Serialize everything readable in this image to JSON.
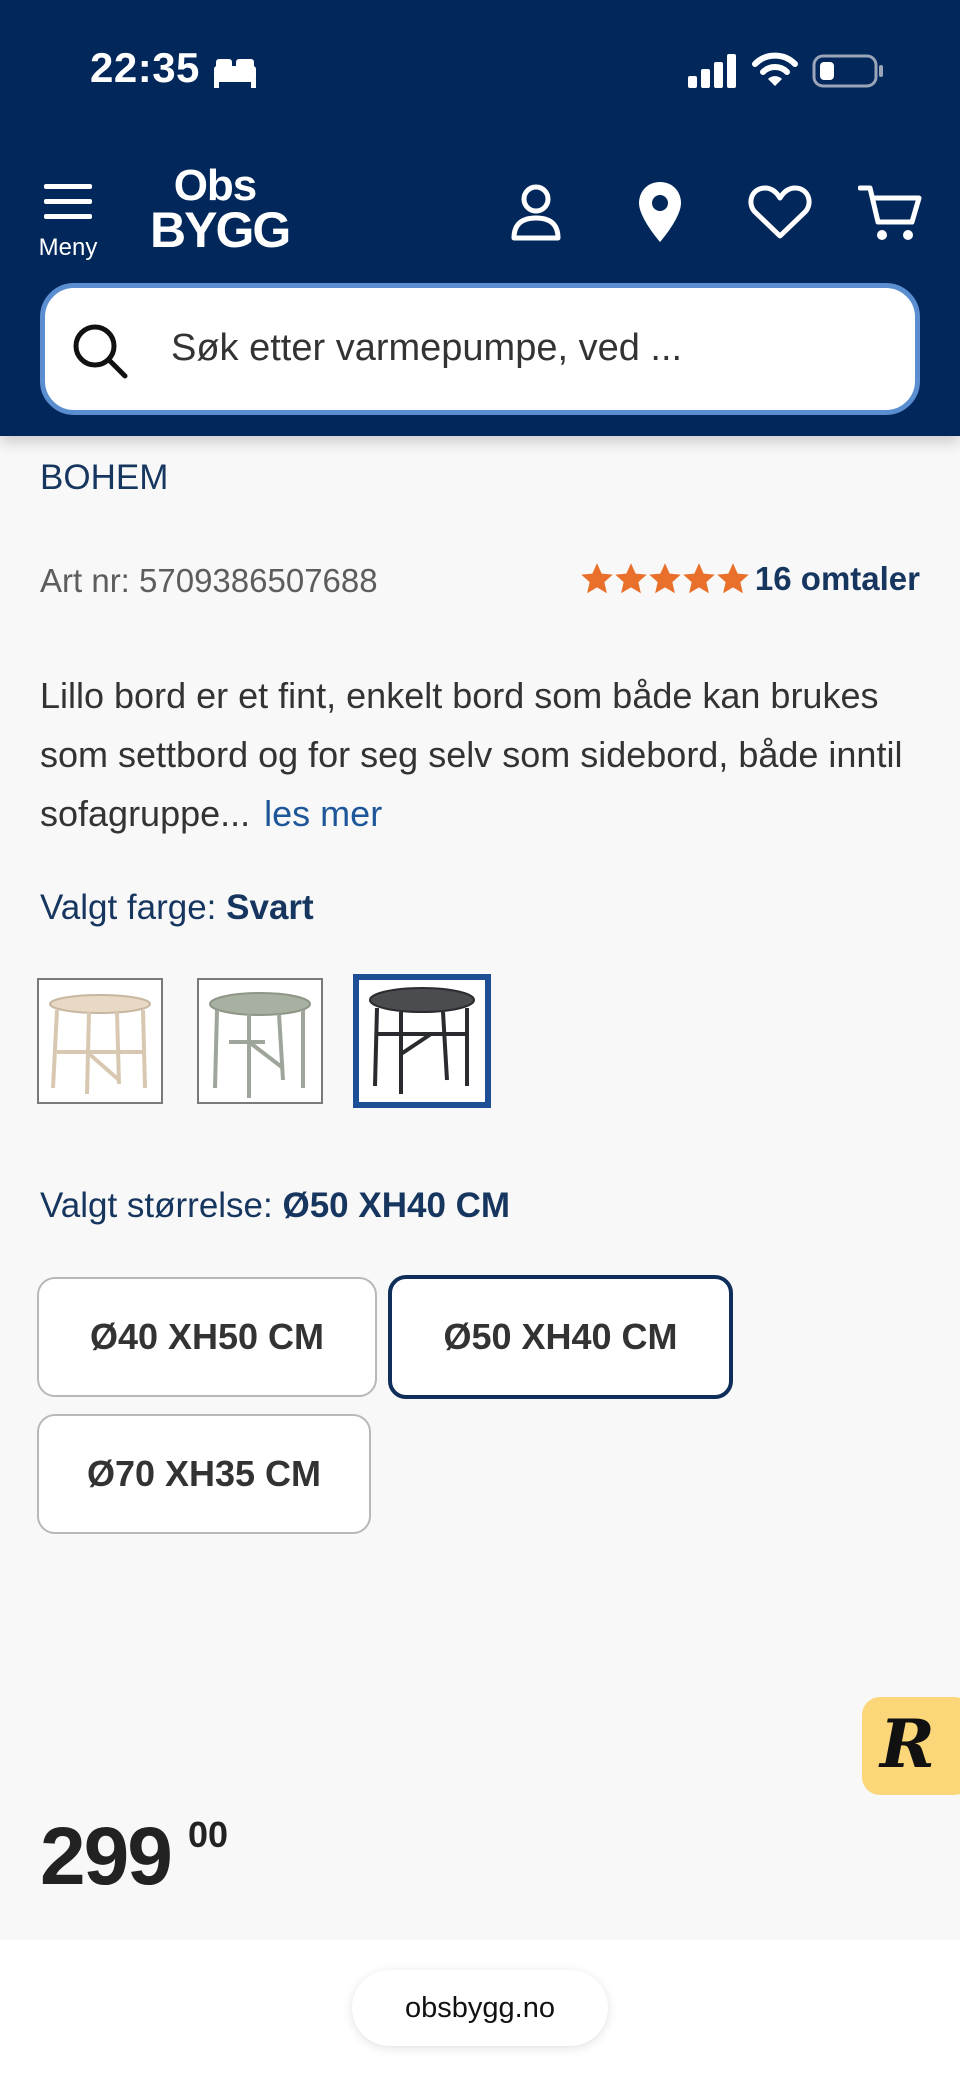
{
  "status_bar": {
    "time": "22:35"
  },
  "header": {
    "menu_label": "Meny",
    "logo_line1": "Obs",
    "logo_line2": "BYGG",
    "search": {
      "placeholder": "Søk etter varmepumpe, ved ..."
    }
  },
  "product": {
    "name_partial": "Bohem Lillo bord",
    "brand": "BOHEM",
    "article_number": "Art nr: 5709386507688",
    "rating": {
      "stars": 5,
      "reviews": "16 omtaler",
      "color": "#e8702a"
    },
    "description": "Lillo bord er et fint, enkelt bord som både kan brukes som settbord og for seg selv som sidebord, både inntil sofagruppe...",
    "read_more": "les mer",
    "color_label": "Valgt farge:",
    "color_value": "Svart",
    "colors": [
      {
        "name": "beige",
        "hex": "#e8d8c4"
      },
      {
        "name": "grønn",
        "hex": "#a8b0a2"
      },
      {
        "name": "svart",
        "hex": "#4a4c50"
      }
    ],
    "size_label": "Valgt størrelse:",
    "size_value": "Ø50 XH40 CM",
    "sizes": [
      "Ø40 XH50 CM",
      "Ø50 XH40 CM",
      "Ø70 XH35 CM"
    ],
    "selected_size_index": 1,
    "price_int": "299",
    "price_dec": "00"
  },
  "browser": {
    "url": "obsbygg.no"
  },
  "colors": {
    "header_bg": "#02275a",
    "accent": "#1d4f96",
    "chat_bg": "#fcd77a"
  }
}
